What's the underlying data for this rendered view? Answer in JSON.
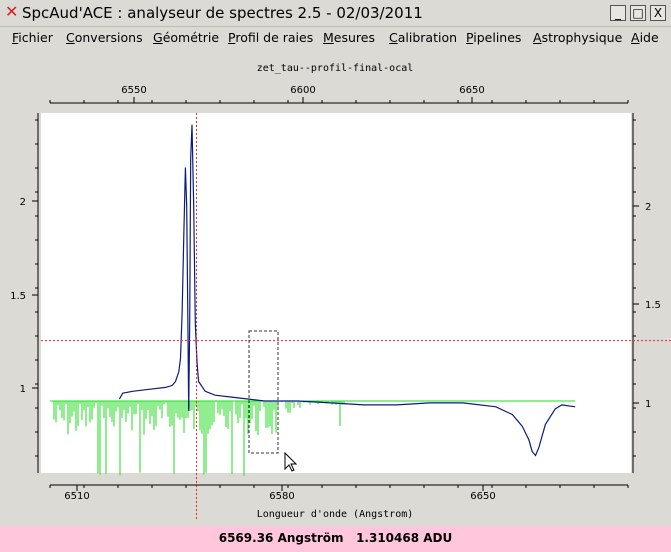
{
  "window": {
    "title": "SpcAud'ACE : analyseur de spectres 2.5 - 02/03/2011",
    "minimize": "_",
    "maximize": "□",
    "close": "X"
  },
  "menu": [
    {
      "label": "Fichier",
      "u": "F",
      "rest": "ichier"
    },
    {
      "label": "Conversions",
      "u": "C",
      "rest": "onversions"
    },
    {
      "label": "Géométrie",
      "u": "G",
      "rest": "éométrie"
    },
    {
      "label": "Profil de raies",
      "u": "P",
      "rest": "rofil de raies"
    },
    {
      "label": "Mesures",
      "u": "M",
      "rest": "esures"
    },
    {
      "label": "Calibration",
      "u": "C",
      "rest": "alibration"
    },
    {
      "label": "Pipelines",
      "u": "P",
      "rest": "ipelines"
    },
    {
      "label": "Astrophysique",
      "u": "A",
      "rest": "strophysique"
    },
    {
      "label": "Aide",
      "u": "A",
      "rest": "ide"
    }
  ],
  "plot": {
    "title": "zet_tau--profil-final-ocal",
    "xlabel": "Longueur d'onde (Angstrom)",
    "top_ticks": [
      "6550",
      "6600",
      "6650"
    ],
    "bottom_ticks": [
      "6510",
      "6580",
      "6650"
    ],
    "left_ticks": [
      "2",
      "1.5",
      "1"
    ],
    "right_ticks": [
      "2",
      "1.5",
      "1"
    ],
    "series_color": "#0d1a80",
    "reference_color": "#22dd22",
    "cursor_color": "#ee2222"
  },
  "status": {
    "text": "6569.36 Angström   1.310468 ADU"
  },
  "chart_data": {
    "type": "line",
    "title": "zet_tau--profil-final-ocal",
    "xlabel": "Longueur d'onde (Angstrom)",
    "ylabel": "",
    "xlim": [
      6525,
      6700
    ],
    "ylim": [
      0.63,
      2.48
    ],
    "cursor": {
      "x": 6569.36,
      "y": 1.310468
    },
    "series": [
      {
        "x": [
          6546,
          6547,
          6550,
          6555,
          6560,
          6562,
          6563,
          6564,
          6564.5,
          6565,
          6565.5,
          6566,
          6566.4,
          6566.7,
          6567,
          6567.3,
          6567.6,
          6568,
          6568.5,
          6569,
          6569.5,
          6570,
          6572,
          6575,
          6580,
          6590,
          6600,
          6610,
          6620,
          6630,
          6640,
          6650,
          6660,
          6665,
          6668,
          6670,
          6671,
          6672,
          6673,
          6675,
          6678,
          6680,
          6684
        ],
        "values": [
          1.01,
          1.04,
          1.05,
          1.06,
          1.07,
          1.08,
          1.1,
          1.15,
          1.22,
          1.45,
          1.85,
          2.2,
          2.0,
          1.5,
          0.95,
          1.4,
          2.25,
          2.42,
          2.0,
          1.4,
          1.2,
          1.1,
          1.05,
          1.03,
          1.02,
          1.0,
          1.0,
          0.99,
          0.98,
          0.98,
          0.99,
          0.99,
          0.97,
          0.93,
          0.87,
          0.8,
          0.74,
          0.72,
          0.76,
          0.88,
          0.96,
          0.98,
          0.97
        ]
      },
      {
        "x": [
          6525,
          6684
        ],
        "values": [
          1.0,
          1.0
        ]
      }
    ]
  }
}
